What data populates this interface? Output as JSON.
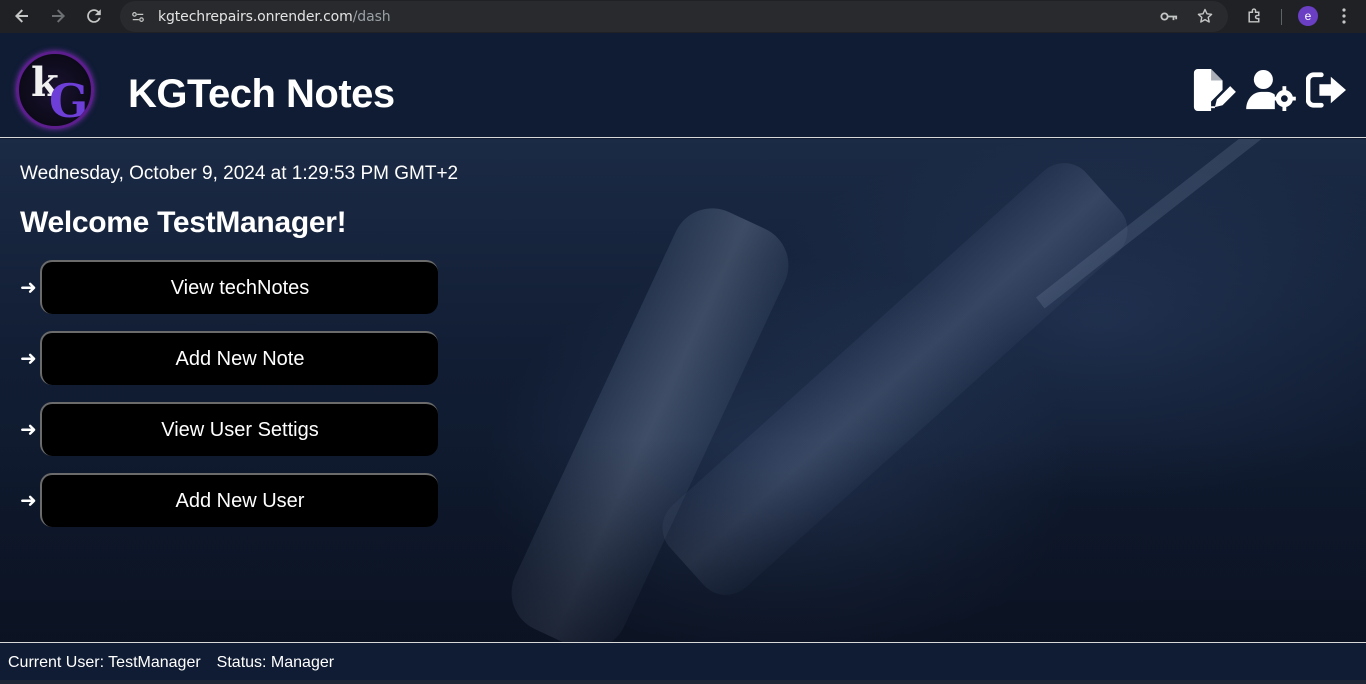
{
  "browser": {
    "url_host": "kgtechrepairs.onrender.com",
    "url_path": "/dash",
    "profile_initial": "e"
  },
  "header": {
    "title": "KGTech Notes",
    "logo_text_k": "k",
    "logo_text_g": "G",
    "actions": [
      "new-note-icon",
      "user-settings-icon",
      "logout-icon"
    ]
  },
  "main": {
    "datetime": "Wednesday, October 9, 2024 at 1:29:53 PM GMT+2",
    "welcome": "Welcome TestManager!",
    "arrow": "➜",
    "links": [
      {
        "label": "View techNotes"
      },
      {
        "label": "Add New Note"
      },
      {
        "label": "View User Settigs"
      },
      {
        "label": "Add New User"
      }
    ]
  },
  "footer": {
    "current_user": "Current User: TestManager",
    "status": "Status: Manager"
  },
  "colors": {
    "background": "#0f1c33",
    "button": "#000000",
    "text": "#ffffff",
    "logo_accent": "#6d3fd8"
  }
}
